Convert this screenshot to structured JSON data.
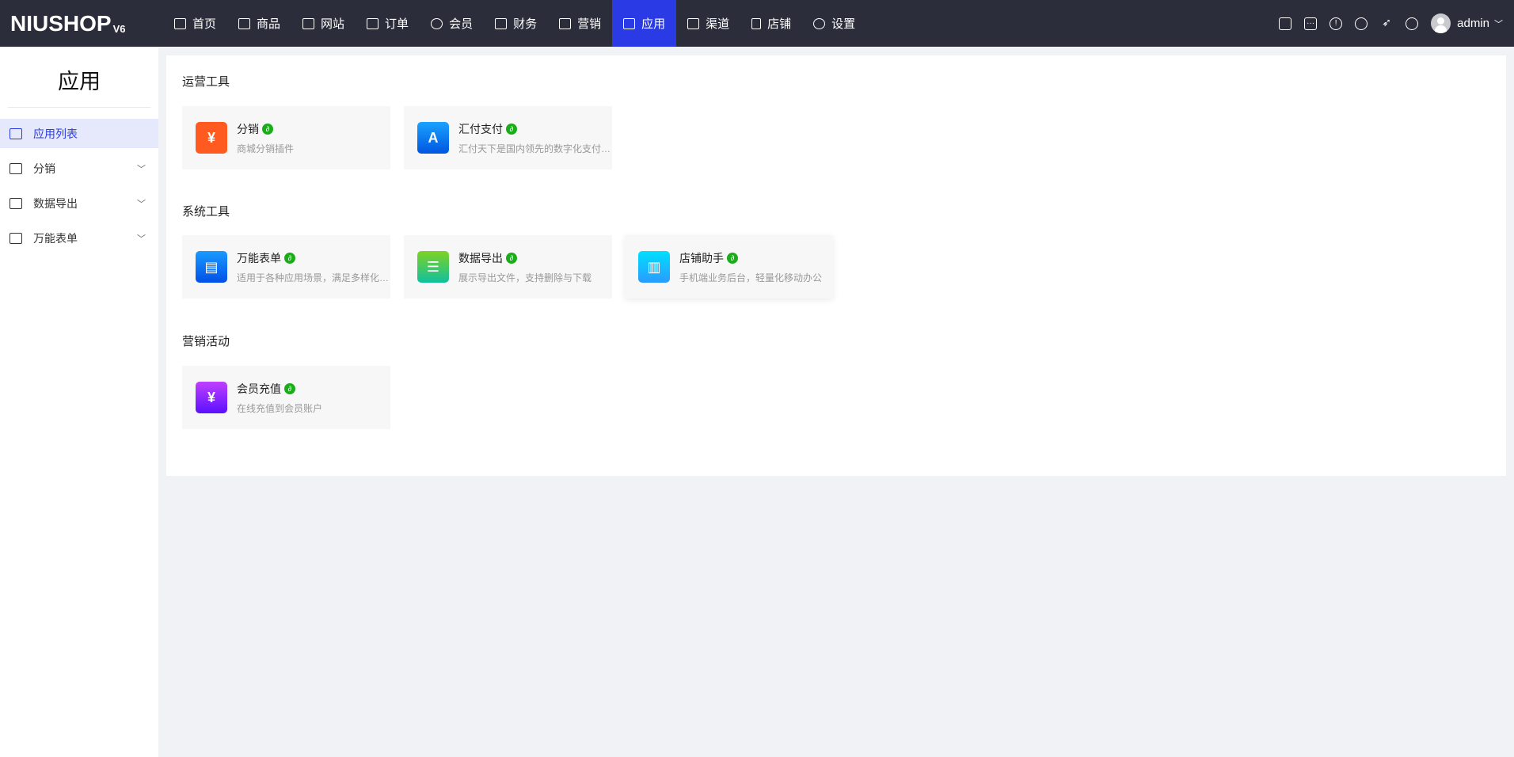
{
  "header": {
    "logo": "NIUSHOP",
    "logo_version": "V6",
    "nav": [
      {
        "label": "首页",
        "icon": "monitor-icon"
      },
      {
        "label": "商品",
        "icon": "goods-icon"
      },
      {
        "label": "网站",
        "icon": "website-icon"
      },
      {
        "label": "订单",
        "icon": "order-icon"
      },
      {
        "label": "会员",
        "icon": "member-icon"
      },
      {
        "label": "财务",
        "icon": "finance-icon"
      },
      {
        "label": "营销",
        "icon": "marketing-icon"
      },
      {
        "label": "应用",
        "icon": "app-icon",
        "active": true
      },
      {
        "label": "渠道",
        "icon": "channel-icon"
      },
      {
        "label": "店铺",
        "icon": "store-icon"
      },
      {
        "label": "设置",
        "icon": "gear-icon"
      }
    ],
    "user": "admin"
  },
  "sidebar": {
    "title": "应用",
    "items": [
      {
        "label": "应用列表",
        "active": true
      },
      {
        "label": "分销"
      },
      {
        "label": "数据导出"
      },
      {
        "label": "万能表单"
      }
    ]
  },
  "sections": [
    {
      "title": "运营工具",
      "apps": [
        {
          "name": "分销",
          "desc": "商城分销插件",
          "color": "#ff5a1f"
        },
        {
          "name": "汇付支付",
          "desc": "汇付天下是国内领先的数字化支付服务商",
          "color": "#1677ff"
        }
      ]
    },
    {
      "title": "系统工具",
      "apps": [
        {
          "name": "万能表单",
          "desc": "适用于各种应用场景，满足多样化的业务需求",
          "color": "#1a73ff"
        },
        {
          "name": "数据导出",
          "desc": "展示导出文件，支持删除与下载",
          "color": "#52c41a"
        },
        {
          "name": "店铺助手",
          "desc": "手机端业务后台，轻量化移动办公",
          "color": "#00c8ff"
        }
      ]
    },
    {
      "title": "营销活动",
      "apps": [
        {
          "name": "会员充值",
          "desc": "在线充值到会员账户",
          "color": "#8a2cff"
        }
      ]
    }
  ]
}
